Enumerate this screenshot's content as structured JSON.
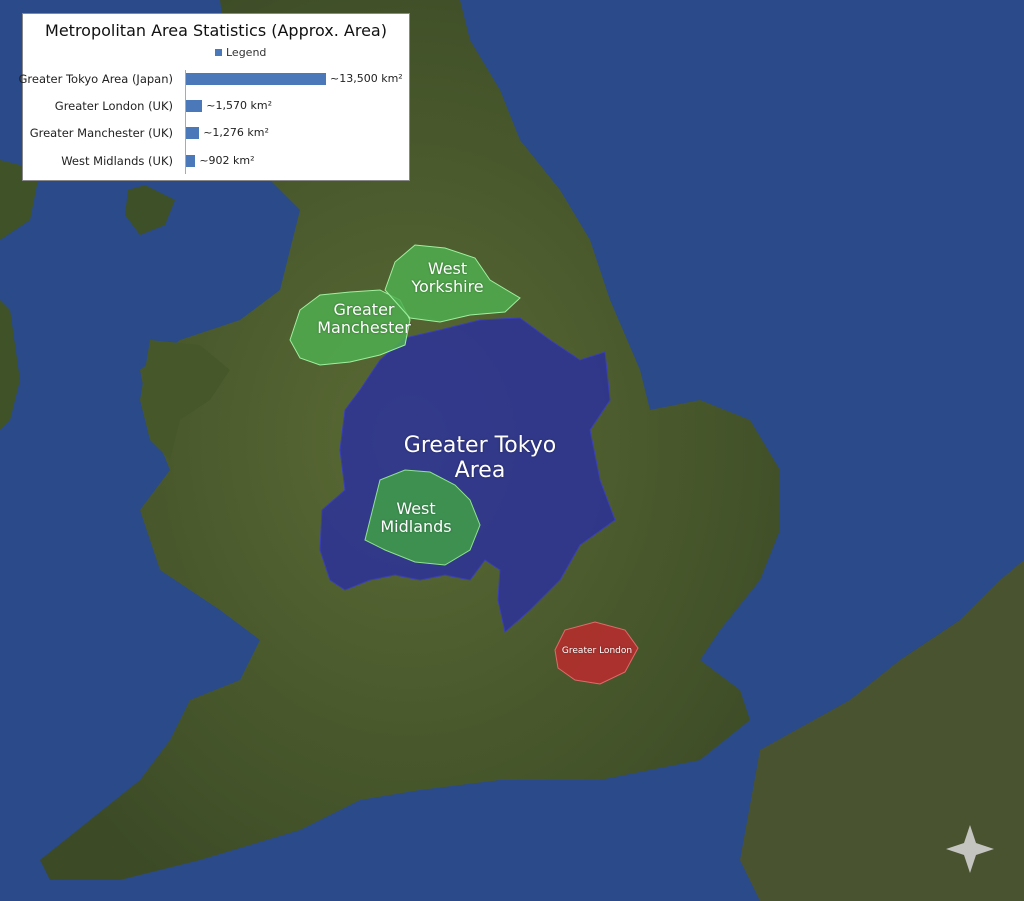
{
  "stats_panel": {
    "title": "Metropolitan Area Statistics (Approx. Area)",
    "legend_label": "Legend",
    "bar_color": "#4a78b8",
    "rows": [
      {
        "label": "Greater Tokyo Area (Japan)",
        "value_text": "~13,500 km²",
        "value": 13500
      },
      {
        "label": "Greater London (UK)",
        "value_text": "~1,570 km²",
        "value": 1570
      },
      {
        "label": "Greater Manchester (UK)",
        "value_text": "~1,276 km²",
        "value": 1276
      },
      {
        "label": "West Midlands (UK)",
        "value_text": "~902 km²",
        "value": 902
      }
    ]
  },
  "regions": {
    "greater_tokyo": {
      "label_line1": "Greater Tokyo",
      "label_line2": "Area",
      "fill": "#2b2f9e"
    },
    "west_midlands": {
      "label_line1": "West",
      "label_line2": "Midlands",
      "fill": "#3f9a4a"
    },
    "greater_manchester": {
      "label_line1": "Greater",
      "label_line2": "Manchester",
      "fill": "#4fae4f"
    },
    "west_yorkshire": {
      "label_line1": "West",
      "label_line2": "Yorkshire",
      "fill": "#4fae4f"
    },
    "greater_london": {
      "label": "Greater London",
      "fill": "#b52d2d"
    }
  },
  "colors": {
    "sea": "#2a4a8a",
    "land": "#4a5a2e"
  }
}
